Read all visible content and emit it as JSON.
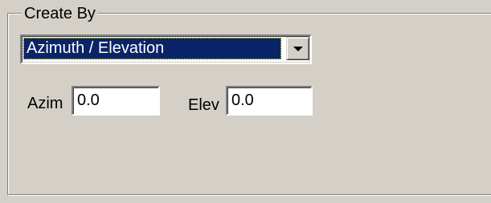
{
  "group": {
    "title": "Create By"
  },
  "method_select": {
    "selected": "Azimuth / Elevation"
  },
  "fields": {
    "azim": {
      "label": "Azim",
      "value": "0.0"
    },
    "elev": {
      "label": "Elev",
      "value": "0.0"
    }
  },
  "icons": {
    "dropdown": "chevron-down-icon"
  }
}
